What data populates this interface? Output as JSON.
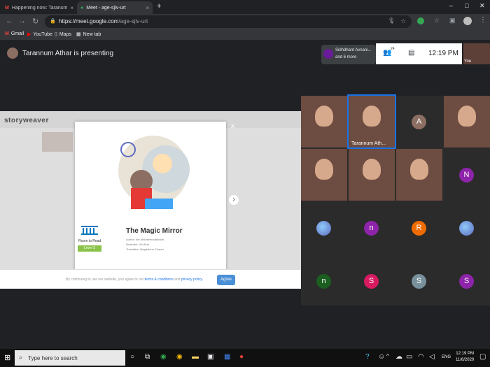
{
  "browser": {
    "tabs": [
      {
        "title": "Happening now: Taranum Athar",
        "active": false
      },
      {
        "title": "Meet - age-sjiv-urt",
        "active": true
      }
    ],
    "new_tab": "+",
    "url_host": "https://meet.google.com",
    "url_path": "/age-sjiv-urt",
    "bookmarks": [
      "Gmail",
      "YouTube",
      "Maps",
      "New tab"
    ]
  },
  "meet": {
    "presenter_text": "Tarannum Athar is presenting",
    "participants_chip": {
      "name": "Sidhdhant Avnani...",
      "more": "and 6 more"
    },
    "participant_count": "24",
    "clock": "12:19 PM",
    "self_label": "You",
    "presentation": {
      "site_logo": "storyweaver",
      "book_title": "The Magic Mirror",
      "author_label": "Author: Ibn Mohammedalloolin",
      "illustrator_label": "Illustrator: Uti Wrer",
      "translator_label": "Translator: Magdalena Cooper",
      "publisher": "Room to Read",
      "level": "Level 3",
      "close": "x",
      "next": "›",
      "consent_prefix": "By continuing to use our website, you agree to our",
      "consent_terms": "terms & conditions",
      "consent_and": "and",
      "consent_privacy": "privacy policy.",
      "agree": "Agree"
    },
    "tiles": [
      {
        "type": "video",
        "label": ""
      },
      {
        "type": "video",
        "label": "Tarannum Ath..."
      },
      {
        "type": "initial",
        "letter": "A",
        "color": "#8d6e63"
      },
      {
        "type": "video",
        "label": ""
      },
      {
        "type": "video",
        "label": ""
      },
      {
        "type": "video",
        "label": ""
      },
      {
        "type": "video",
        "label": ""
      },
      {
        "type": "initial",
        "letter": "N",
        "color": "#8e24aa"
      },
      {
        "type": "avatar",
        "label": ""
      },
      {
        "type": "initial",
        "letter": "n",
        "color": "#8e24aa"
      },
      {
        "type": "initial",
        "letter": "R",
        "color": "#ef6c00"
      },
      {
        "type": "avatar",
        "label": ""
      },
      {
        "type": "initial",
        "letter": "n",
        "color": "#1b5e20"
      },
      {
        "type": "initial",
        "letter": "S",
        "color": "#d81b60"
      },
      {
        "type": "initial",
        "letter": "S",
        "color": "#78909c"
      },
      {
        "type": "initial",
        "letter": "S",
        "color": "#8e24aa"
      }
    ]
  },
  "taskbar": {
    "search_placeholder": "Type here to search",
    "lang": "ENG",
    "time": "12:19 PM",
    "date": "11/6/2020"
  }
}
